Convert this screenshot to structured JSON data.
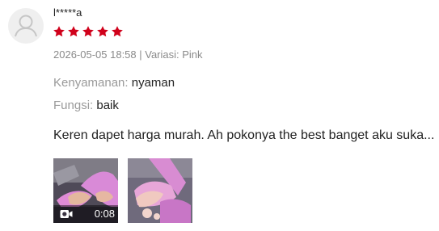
{
  "review": {
    "username": "l*****a",
    "rating": 5,
    "rating_max": 5,
    "timestamp_variant": "2026-05-05 18:58 | Variasi: Pink",
    "attributes": [
      {
        "label": "Kenyamanan:",
        "value": "nyaman"
      },
      {
        "label": "Fungsi:",
        "value": "baik"
      }
    ],
    "comment": "Keren dapet harga murah. Ah pokonya the best banget aku suka...",
    "media": [
      {
        "type": "video",
        "duration": "0:08",
        "icon": "video-camera-icon"
      },
      {
        "type": "image"
      }
    ]
  },
  "colors": {
    "star": "#d0011b",
    "meta_text": "#8a8a8a",
    "attribute_label": "#9a9a9a",
    "text": "#222222",
    "avatar_bg": "#efefef",
    "avatar_icon": "#c6c6c6"
  }
}
